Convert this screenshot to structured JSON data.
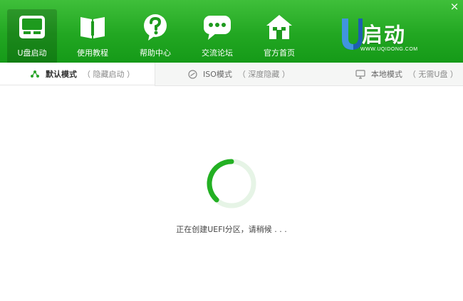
{
  "window": {
    "close_glyph": "×"
  },
  "nav": [
    {
      "label": "U盘启动",
      "icon": "usb-disk-icon",
      "active": true
    },
    {
      "label": "使用教程",
      "icon": "book-icon",
      "active": false
    },
    {
      "label": "帮助中心",
      "icon": "question-bubble-icon",
      "active": false
    },
    {
      "label": "交流论坛",
      "icon": "chat-bubble-icon",
      "active": false
    },
    {
      "label": "官方首页",
      "icon": "home-icon",
      "active": false
    }
  ],
  "brand": {
    "text": "启动",
    "logo_letter": "U",
    "url": "WWW.UQIDONG.COM"
  },
  "tabs": [
    {
      "label": "默认模式",
      "sub": "（ 隐藏启动 ）",
      "icon": "share-icon",
      "active": true
    },
    {
      "label": "ISO模式",
      "sub": "（ 深度隐藏 ）",
      "icon": "disc-icon",
      "active": false
    },
    {
      "label": "本地模式",
      "sub": "（ 无需U盘 ）",
      "icon": "monitor-icon",
      "active": false
    }
  ],
  "status": {
    "message": "正在创建UEFI分区，请稍候 . . ."
  },
  "colors": {
    "header_green": "#22a722",
    "spinner_green": "#23b023",
    "spinner_track": "#e6f4e6"
  }
}
